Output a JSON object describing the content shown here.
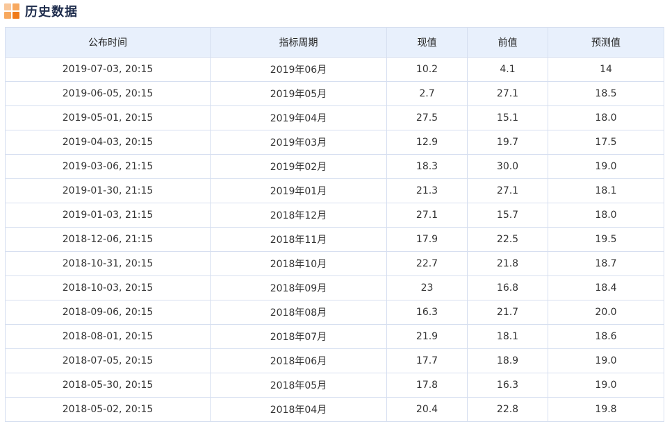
{
  "section": {
    "title": "历史数据",
    "icon": "grid-icon",
    "icon_colors": [
      "#f9c79a",
      "#f7a85e",
      "#f7a85e",
      "#ef7a1a"
    ]
  },
  "table": {
    "headers": [
      "公布时间",
      "指标周期",
      "现值",
      "前值",
      "预测值"
    ],
    "rows": [
      [
        "2019-07-03, 20:15",
        "2019年06月",
        "10.2",
        "4.1",
        "14"
      ],
      [
        "2019-06-05, 20:15",
        "2019年05月",
        "2.7",
        "27.1",
        "18.5"
      ],
      [
        "2019-05-01, 20:15",
        "2019年04月",
        "27.5",
        "15.1",
        "18.0"
      ],
      [
        "2019-04-03, 20:15",
        "2019年03月",
        "12.9",
        "19.7",
        "17.5"
      ],
      [
        "2019-03-06, 21:15",
        "2019年02月",
        "18.3",
        "30.0",
        "19.0"
      ],
      [
        "2019-01-30, 21:15",
        "2019年01月",
        "21.3",
        "27.1",
        "18.1"
      ],
      [
        "2019-01-03, 21:15",
        "2018年12月",
        "27.1",
        "15.7",
        "18.0"
      ],
      [
        "2018-12-06, 21:15",
        "2018年11月",
        "17.9",
        "22.5",
        "19.5"
      ],
      [
        "2018-10-31, 20:15",
        "2018年10月",
        "22.7",
        "21.8",
        "18.7"
      ],
      [
        "2018-10-03, 20:15",
        "2018年09月",
        "23",
        "16.8",
        "18.4"
      ],
      [
        "2018-09-06, 20:15",
        "2018年08月",
        "16.3",
        "21.7",
        "20.0"
      ],
      [
        "2018-08-01, 20:15",
        "2018年07月",
        "21.9",
        "18.1",
        "18.6"
      ],
      [
        "2018-07-05, 20:15",
        "2018年06月",
        "17.7",
        "18.9",
        "19.0"
      ],
      [
        "2018-05-30, 20:15",
        "2018年05月",
        "17.8",
        "16.3",
        "19.0"
      ],
      [
        "2018-05-02, 20:15",
        "2018年04月",
        "20.4",
        "22.8",
        "19.8"
      ]
    ]
  }
}
